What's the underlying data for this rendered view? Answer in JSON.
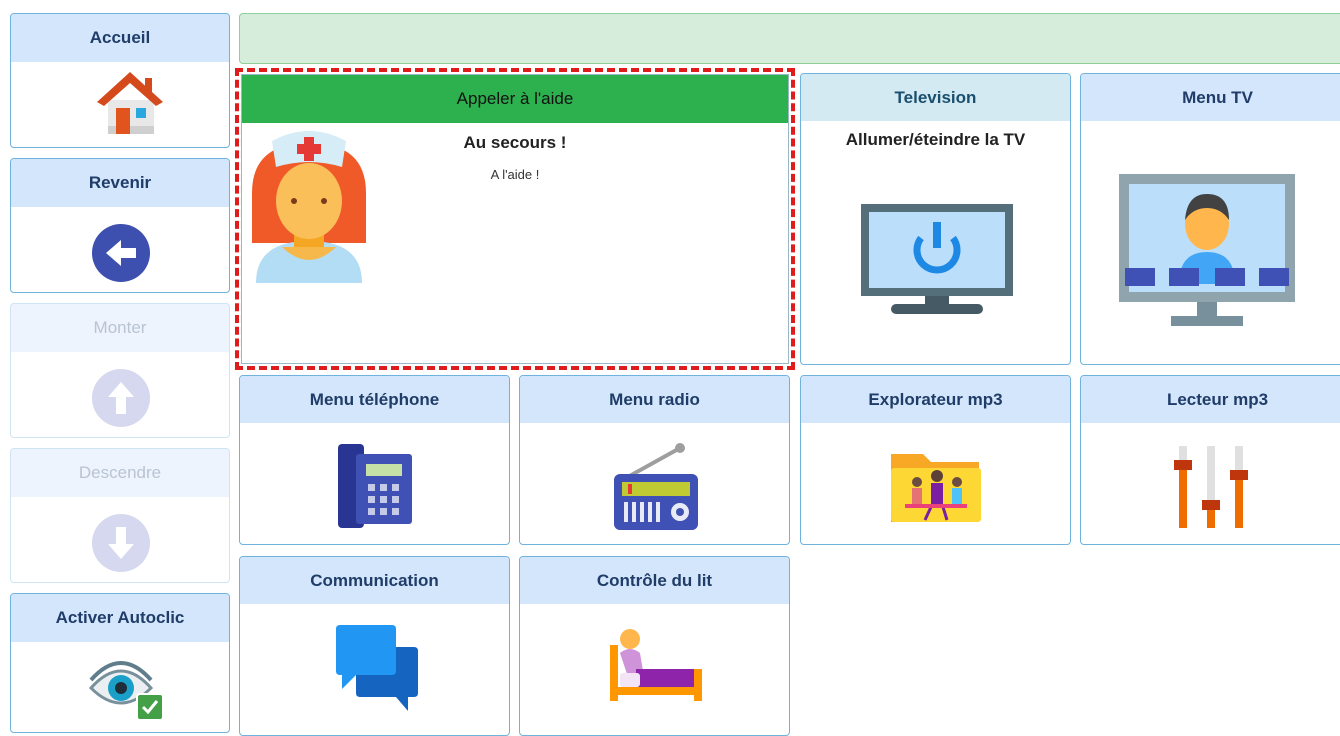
{
  "sidebar": {
    "accueil": "Accueil",
    "revenir": "Revenir",
    "monter": "Monter",
    "descendre": "Descendre",
    "autoclic": "Activer Autoclic"
  },
  "help": {
    "header": "Appeler à l'aide",
    "title": "Au secours !",
    "text": "A l'aide !"
  },
  "tiles": {
    "television": {
      "label": "Television",
      "text": "Allumer/éteindre la TV"
    },
    "menu_tv": "Menu TV",
    "menu_telephone": "Menu téléphone",
    "menu_radio": "Menu radio",
    "explorateur_mp3": "Explorateur mp3",
    "lecteur_mp3": "Lecteur mp3",
    "communication": "Communication",
    "controle_lit": "Contrôle du lit"
  },
  "icons": {
    "home": "house-icon",
    "back": "arrow-left-icon",
    "up": "arrow-up-icon",
    "down": "arrow-down-icon",
    "autoclic": "eye-check-icon",
    "help": "nurse-icon",
    "tv": "tv-power-icon",
    "menu_tv": "tv-person-icon",
    "phone": "desk-phone-icon",
    "radio": "radio-icon",
    "mp3_explorer": "music-folder-icon",
    "mp3_player": "equalizer-icon",
    "communication": "chat-bubbles-icon",
    "bed": "bed-icon"
  },
  "colors": {
    "help_header": "#2db14f",
    "tile_header": "#d4e6fb",
    "selection_border": "#e01b1b",
    "top_bar": "#d6eddb"
  }
}
